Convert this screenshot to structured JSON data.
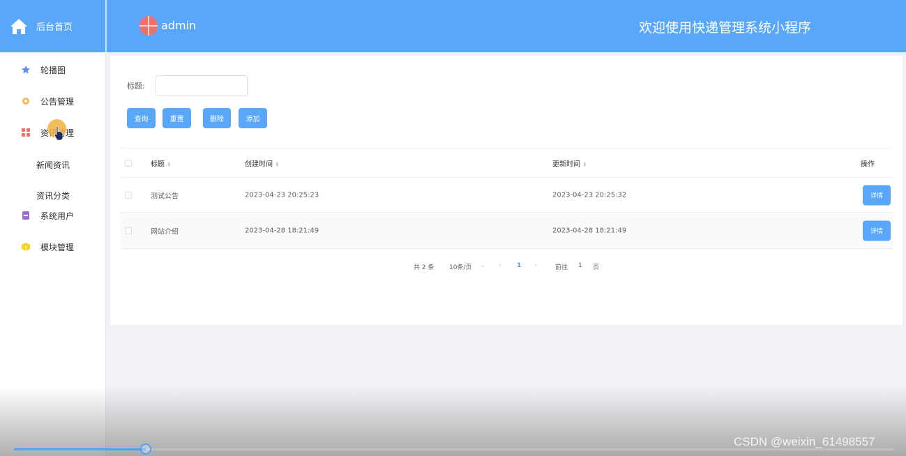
{
  "sidebar": {
    "brand": {
      "label": "后台首页",
      "icon": "home-icon"
    },
    "items": [
      {
        "label": "轮播图",
        "icon": "star-icon",
        "color": "#5b8ff9"
      },
      {
        "label": "公告管理",
        "icon": "gear-icon",
        "color": "#f5b85b"
      },
      {
        "label": "资讯管理",
        "icon": "grid-icon",
        "color": "#f27063"
      },
      {
        "label": "新闻资讯"
      },
      {
        "label": "资讯分类"
      },
      {
        "label": "系统用户",
        "icon": "user-box-icon",
        "color": "#9b6fce"
      },
      {
        "label": "模块管理",
        "icon": "cube-icon",
        "color": "#f7d21f"
      }
    ]
  },
  "header": {
    "user": "admin",
    "welcome": "欢迎使用快递管理系统小程序"
  },
  "search": {
    "title_label": "标题:",
    "title_value": "",
    "buttons": {
      "query": "查询",
      "reset": "重置",
      "delete": "删除",
      "add": "添加"
    }
  },
  "table": {
    "headers": {
      "title": "标题",
      "created": "创建时间",
      "updated": "更新时间",
      "actions": "操作"
    },
    "rows": [
      {
        "title": "测试公告",
        "created": "2023-04-23 20:25:23",
        "updated": "2023-04-23 20:25:32",
        "action": "详情"
      },
      {
        "title": "网站介绍",
        "created": "2023-04-28 18:21:49",
        "updated": "2023-04-28 18:21:49",
        "action": "详情"
      }
    ]
  },
  "pagination": {
    "total": "共 2 条",
    "page_size": "10条/页",
    "current": "1",
    "goto_prefix": "前往",
    "goto_value": "1",
    "goto_suffix": "页"
  },
  "video": {
    "progress": 0.15,
    "watermark": "CSDN @weixin_61498557"
  },
  "colors": {
    "primary": "#58a7fb",
    "accent": "#409eff"
  }
}
